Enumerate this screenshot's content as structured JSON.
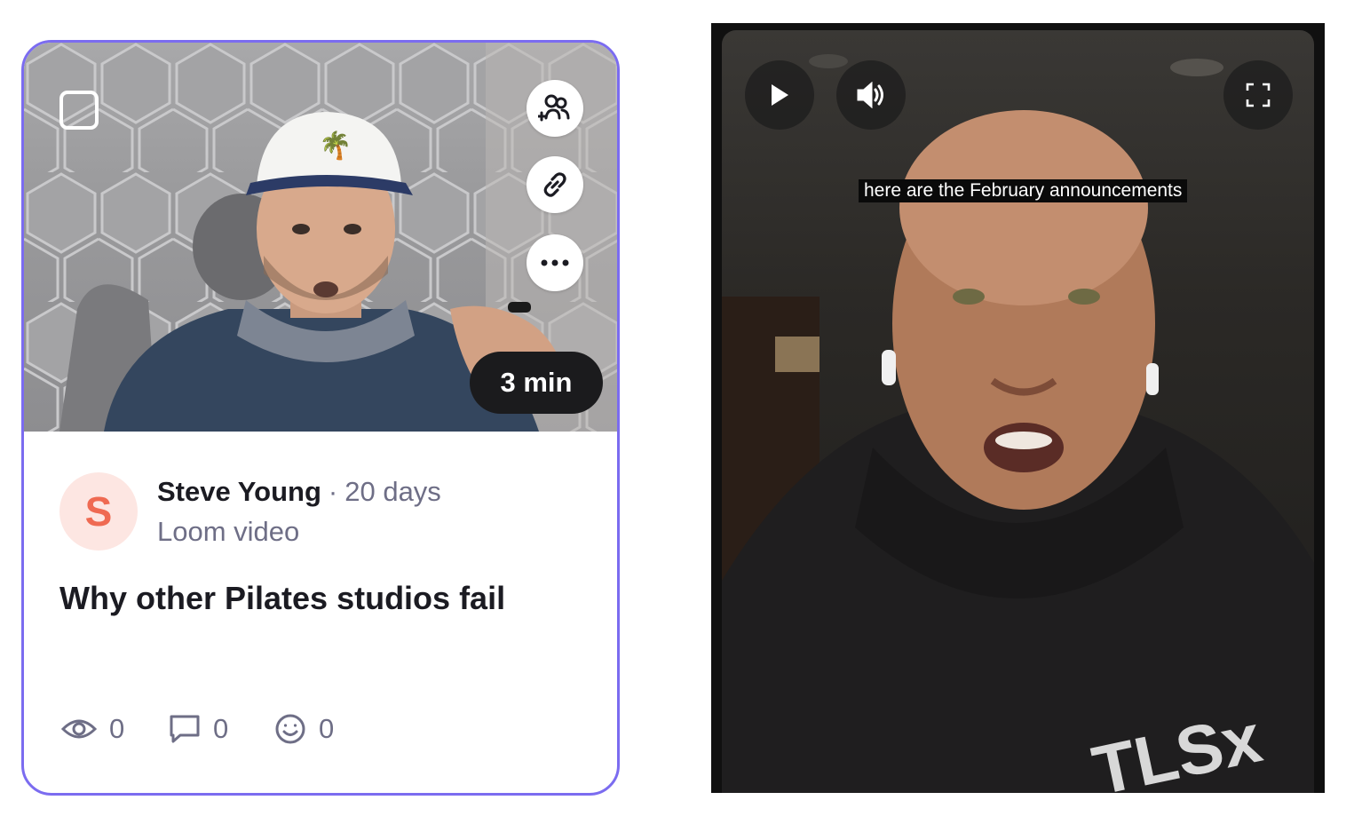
{
  "card": {
    "duration": "3 min",
    "avatar_initial": "S",
    "author": "Steve Young",
    "separator": "·",
    "age": "20 days",
    "source": "Loom video",
    "title": "Why other Pilates studios fail",
    "stats": {
      "views": "0",
      "comments": "0",
      "reactions": "0"
    },
    "icons": {
      "select": "checkbox-icon",
      "share": "add-people-icon",
      "link": "link-icon",
      "more": "more-horizontal-icon",
      "views": "eye-icon",
      "comments": "comment-icon",
      "reactions": "smiley-icon"
    },
    "colors": {
      "border": "#7b6cf0",
      "avatar_bg": "#fde6e2",
      "avatar_fg": "#ef6a52",
      "muted_text": "#6e6e86"
    }
  },
  "player": {
    "caption": "here are the February announcements",
    "hoodie_logo": "TLSx",
    "icons": {
      "play": "play-icon",
      "volume": "volume-icon",
      "fullscreen": "fullscreen-icon"
    }
  }
}
